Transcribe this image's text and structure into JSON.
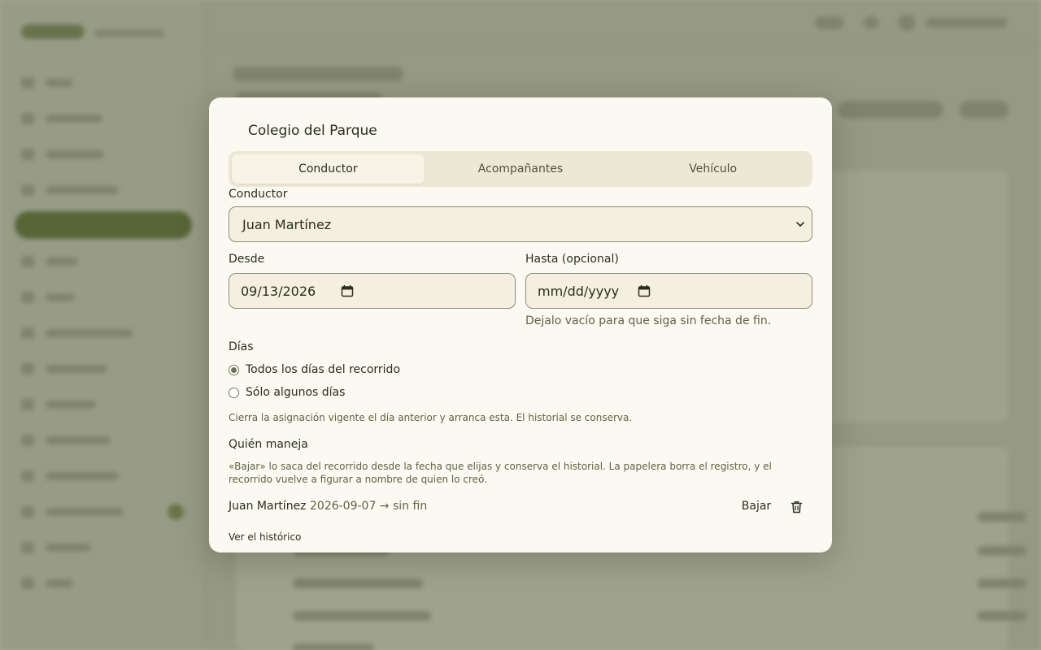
{
  "modal": {
    "title": "Colegio del Parque",
    "tabs": [
      {
        "label": "Conductor",
        "active": true
      },
      {
        "label": "Acompañantes",
        "active": false
      },
      {
        "label": "Vehículo",
        "active": false
      }
    ],
    "driver_label": "Conductor",
    "driver_value": "Juan Martínez",
    "from_label": "Desde",
    "from_value": "09/13/2026",
    "until_label": "Hasta (opcional)",
    "until_placeholder": "mm/dd/yyyy",
    "until_hint": "Dejalo vacío para que siga sin fecha de fin.",
    "days_label": "Días",
    "days_options": [
      {
        "label": "Todos los días del recorrido",
        "selected": true
      },
      {
        "label": "Sólo algunos días",
        "selected": false
      }
    ],
    "days_note": "Cierra la asignación vigente el día anterior y arranca esta. El historial se conserva.",
    "who_label": "Quién maneja",
    "who_note": "«Bajar» lo saca del recorrido desde la fecha que elijas y conserva el historial. La papelera borra el registro, y el recorrido vuelve a figurar a nombre de quien lo creó.",
    "current": {
      "name": "Juan Martínez",
      "range": "2026-09-07 → sin fin",
      "remove_label": "Bajar"
    },
    "history_link": "Ver el histórico"
  },
  "colors": {
    "modal_bg": "#fbf9f1",
    "tab_track": "#ede8d6",
    "accent": "#6e7458"
  },
  "icons": [
    "chevron-down-icon",
    "calendar-icon",
    "trash-icon"
  ]
}
